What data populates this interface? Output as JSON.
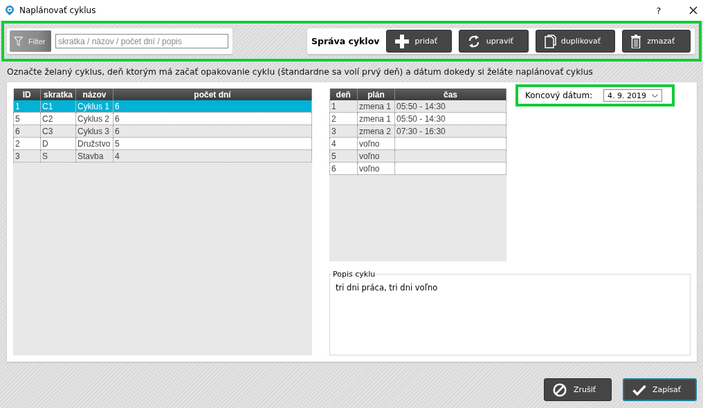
{
  "window": {
    "title": "Naplánovať cyklus",
    "help": "?"
  },
  "filter": {
    "button": "Filter",
    "placeholder": "skratka / názov / počet dní / popis"
  },
  "management": {
    "label": "Správa cyklov",
    "buttons": [
      {
        "kind": "add",
        "label": "pridať"
      },
      {
        "kind": "edit",
        "label": "upraviť"
      },
      {
        "kind": "duplicate",
        "label": "duplikovať"
      },
      {
        "kind": "delete",
        "label": "zmazať"
      }
    ]
  },
  "instruction": "Označte želaný cyklus, deň ktorým má začať opakovanie cyklu (štandardne sa volí prvý deň) a dátum dokedy si želáte naplánovať cyklus",
  "cycles": {
    "columns": [
      "ID",
      "skratka",
      "názov",
      "počet dní"
    ],
    "rows": [
      {
        "selected": true,
        "cells": [
          "1",
          "C1",
          "Cyklus 1",
          "6"
        ]
      },
      {
        "selected": false,
        "cells": [
          "5",
          "C2",
          "Cyklus 2",
          "6"
        ]
      },
      {
        "selected": false,
        "cells": [
          "6",
          "C3",
          "Cyklus 3",
          "6"
        ]
      },
      {
        "selected": false,
        "cells": [
          "2",
          "D",
          "Družstvo",
          "5"
        ]
      },
      {
        "selected": false,
        "cells": [
          "3",
          "S",
          "Stavba",
          "4"
        ]
      }
    ]
  },
  "plan": {
    "columns": [
      "deň",
      "plán",
      "čas"
    ],
    "rows": [
      {
        "selected": false,
        "cells": [
          "1",
          "zmena 1",
          "05:50 - 14:30"
        ]
      },
      {
        "selected": false,
        "cells": [
          "2",
          "zmena 1",
          "05:50 - 14:30"
        ]
      },
      {
        "selected": false,
        "cells": [
          "3",
          "zmena 2",
          "07:30 - 16:30"
        ]
      },
      {
        "selected": false,
        "cells": [
          "4",
          "voľno"
        ]
      },
      {
        "selected": false,
        "cells": [
          "5",
          "voľno"
        ]
      },
      {
        "selected": false,
        "cells": [
          "6",
          "voľno"
        ]
      }
    ]
  },
  "end_date": {
    "label": "Koncový dátum:",
    "value": "4. 9. 2019"
  },
  "description": {
    "legend": "Popis cyklu",
    "text": "tri dni práca, tri dni voľno"
  },
  "footer_buttons": [
    {
      "kind": "cancel",
      "label": "Zrušiť",
      "focused": false
    },
    {
      "kind": "save",
      "label": "Zapísať",
      "focused": true
    }
  ]
}
